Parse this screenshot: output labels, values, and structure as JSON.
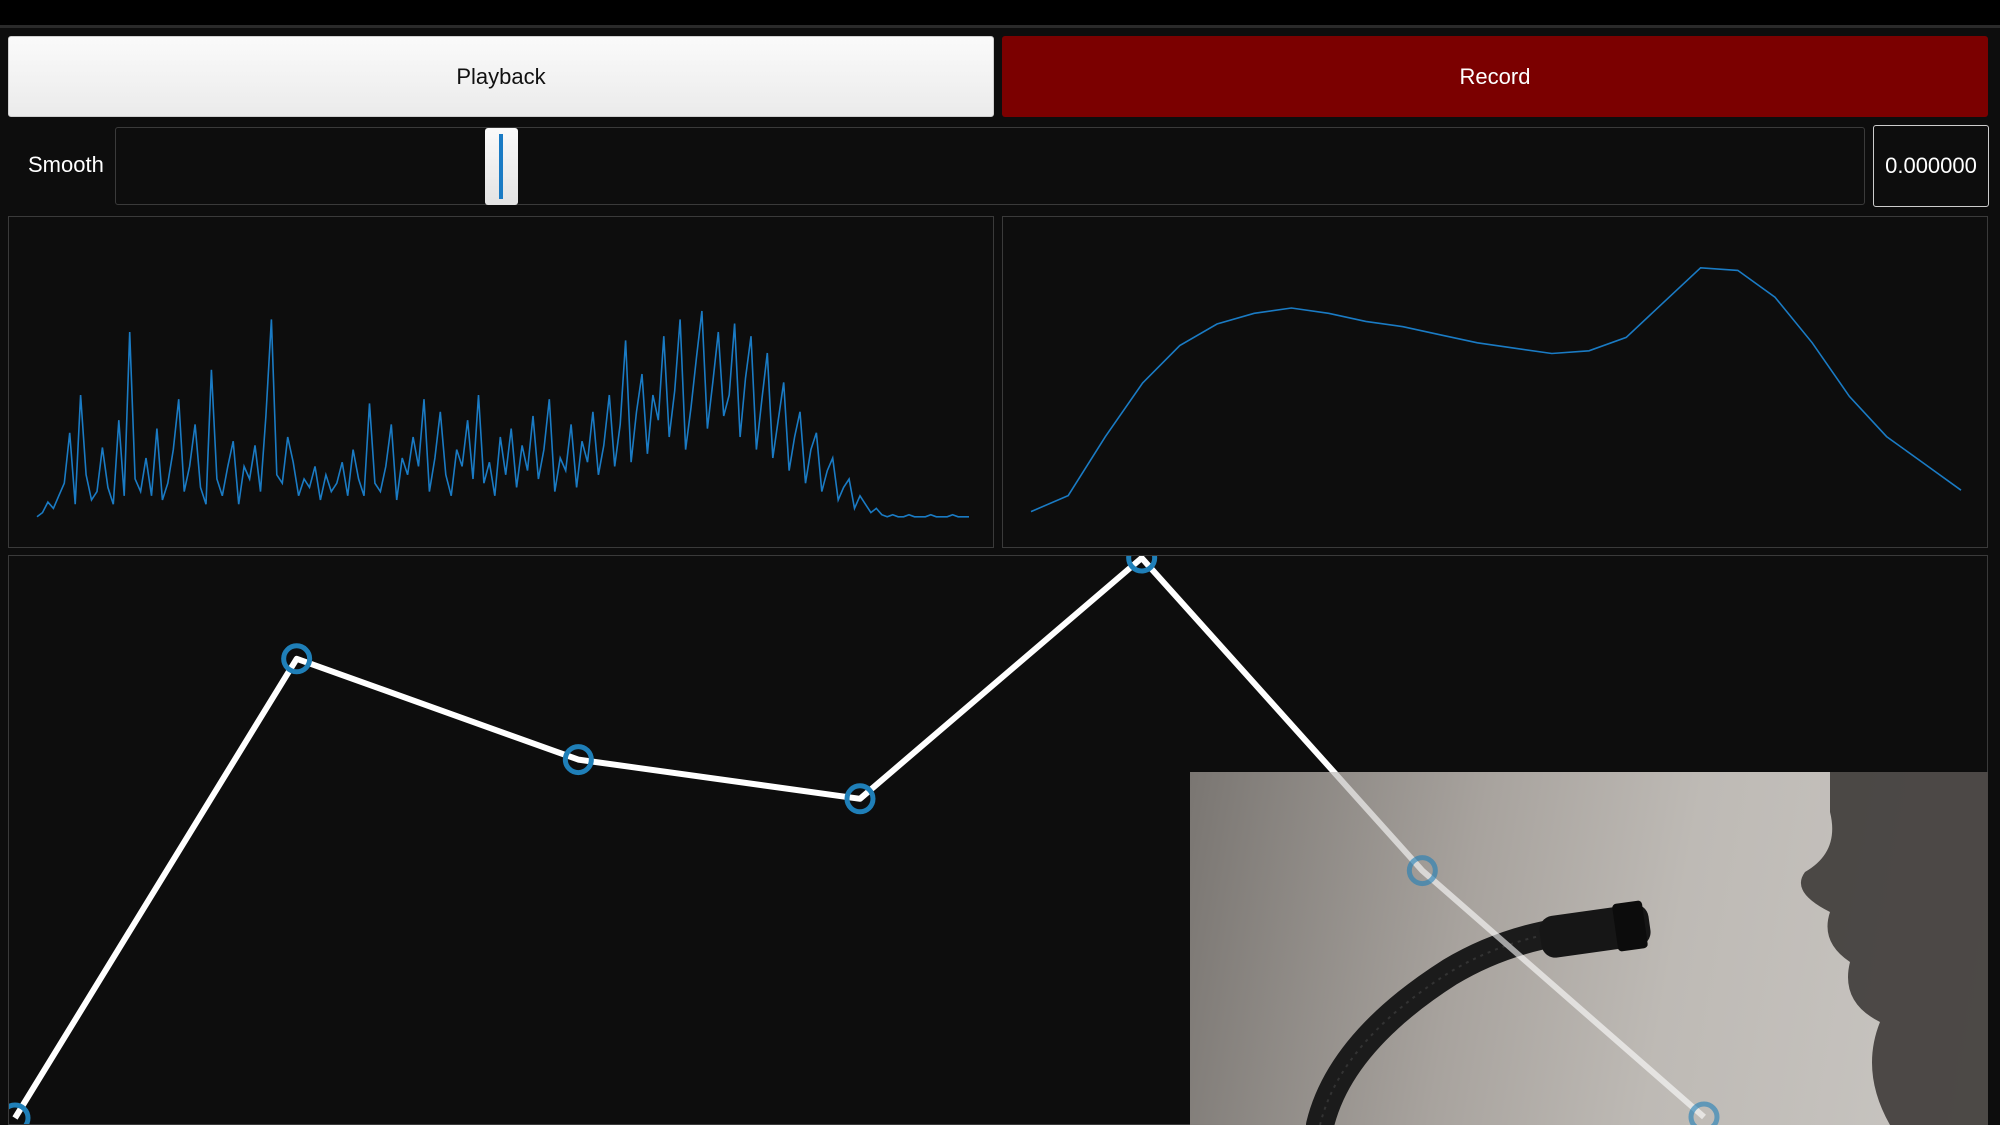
{
  "controls": {
    "playback_label": "Playback",
    "record_label": "Record",
    "smooth_label": "Smooth",
    "smooth_value": "0.000000"
  },
  "colors": {
    "record_bg": "#7b0000",
    "signal_blue": "#1a7bc4",
    "curve_white": "#ffffff",
    "background": "#0d0d0d"
  },
  "icons": {
    "microphone": "microphone-gooseneck"
  },
  "chart_data": [
    {
      "type": "line",
      "name": "waveform",
      "y": [
        2,
        4,
        9,
        6,
        12,
        18,
        42,
        8,
        60,
        22,
        10,
        14,
        35,
        16,
        8,
        48,
        12,
        90,
        20,
        14,
        30,
        12,
        44,
        10,
        18,
        34,
        58,
        14,
        26,
        46,
        16,
        8,
        72,
        20,
        12,
        26,
        38,
        8,
        26,
        20,
        36,
        14,
        50,
        96,
        22,
        18,
        40,
        28,
        12,
        20,
        16,
        26,
        10,
        22,
        14,
        18,
        28,
        12,
        34,
        20,
        12,
        56,
        18,
        14,
        26,
        46,
        10,
        30,
        22,
        40,
        26,
        58,
        14,
        30,
        52,
        22,
        12,
        34,
        26,
        48,
        20,
        60,
        18,
        28,
        12,
        40,
        22,
        44,
        16,
        36,
        24,
        50,
        20,
        34,
        58,
        14,
        30,
        24,
        46,
        16,
        38,
        28,
        52,
        22,
        36,
        60,
        26,
        46,
        86,
        28,
        52,
        70,
        32,
        60,
        48,
        88,
        40,
        62,
        96,
        34,
        54,
        78,
        100,
        44,
        66,
        90,
        50,
        60,
        94,
        40,
        68,
        88,
        34,
        58,
        80,
        30,
        48,
        66,
        24,
        40,
        52,
        18,
        34,
        42,
        14,
        24,
        30,
        10,
        16,
        20,
        6,
        12,
        8,
        4,
        6,
        3,
        2,
        3,
        2,
        2,
        3,
        2,
        2,
        2,
        3,
        2,
        2,
        2,
        3,
        2,
        2,
        2
      ]
    },
    {
      "type": "line",
      "name": "spectrum",
      "y": [
        2,
        8,
        30,
        50,
        64,
        72,
        76,
        78,
        76,
        73,
        71,
        68,
        65,
        63,
        61,
        62,
        67,
        80,
        93,
        92,
        82,
        65,
        45,
        30,
        20,
        10
      ]
    },
    {
      "type": "line",
      "name": "editable-curve",
      "x": [
        0,
        1,
        2,
        3,
        4,
        5,
        6
      ],
      "y": [
        0,
        82,
        64,
        57,
        100,
        44,
        0
      ]
    }
  ]
}
